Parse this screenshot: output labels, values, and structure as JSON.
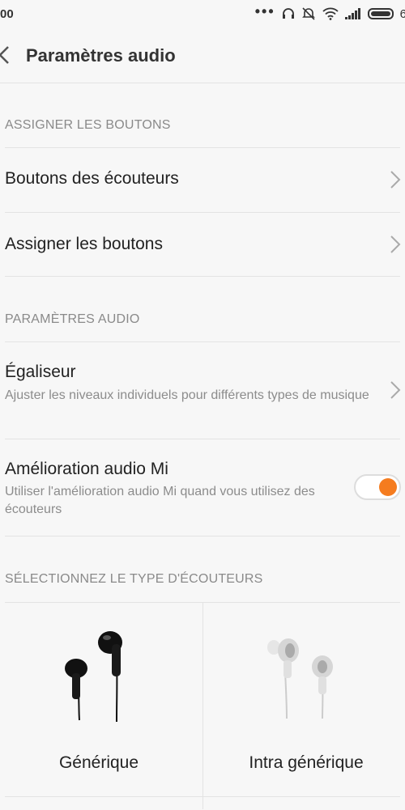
{
  "status": {
    "time": "00",
    "battery_pct": "6",
    "icons": [
      "more-dots-icon",
      "headset-icon",
      "mute-icon",
      "wifi-icon",
      "signal-icon",
      "battery-icon"
    ]
  },
  "header": {
    "title": "Paramètres audio"
  },
  "sections": {
    "buttons": "ASSIGNER LES BOUTONS",
    "audio": "PARAMÈTRES AUDIO",
    "type": "SÉLECTIONNEZ LE TYPE D'ÉCOUTEURS"
  },
  "rows": {
    "headset_buttons": "Boutons des écouteurs",
    "assign_buttons": "Assigner les boutons",
    "equalizer": {
      "title": "Égaliseur",
      "subtitle": "Ajuster les niveaux individuels pour différents types de musique"
    },
    "mi_audio": {
      "title": "Amélioration audio Mi",
      "subtitle": "Utiliser l'amélioration audio Mi quand vous utilisez des écouteurs",
      "enabled": true
    }
  },
  "earphone_types": [
    {
      "label": "Générique",
      "color": "#111111"
    },
    {
      "label": "Intra générique",
      "color": "#d9d9d9"
    }
  ],
  "accent": "#f57c1f"
}
